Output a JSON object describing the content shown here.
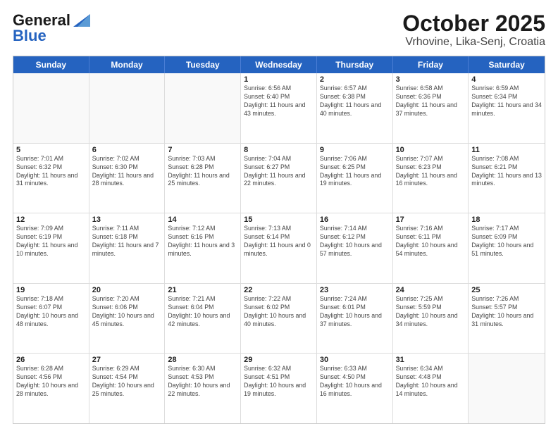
{
  "header": {
    "logo_line1": "General",
    "logo_line2": "Blue",
    "title": "October 2025",
    "subtitle": "Vrhovine, Lika-Senj, Croatia"
  },
  "days_of_week": [
    "Sunday",
    "Monday",
    "Tuesday",
    "Wednesday",
    "Thursday",
    "Friday",
    "Saturday"
  ],
  "weeks": [
    [
      {
        "day": "",
        "info": ""
      },
      {
        "day": "",
        "info": ""
      },
      {
        "day": "",
        "info": ""
      },
      {
        "day": "1",
        "info": "Sunrise: 6:56 AM\nSunset: 6:40 PM\nDaylight: 11 hours and 43 minutes."
      },
      {
        "day": "2",
        "info": "Sunrise: 6:57 AM\nSunset: 6:38 PM\nDaylight: 11 hours and 40 minutes."
      },
      {
        "day": "3",
        "info": "Sunrise: 6:58 AM\nSunset: 6:36 PM\nDaylight: 11 hours and 37 minutes."
      },
      {
        "day": "4",
        "info": "Sunrise: 6:59 AM\nSunset: 6:34 PM\nDaylight: 11 hours and 34 minutes."
      }
    ],
    [
      {
        "day": "5",
        "info": "Sunrise: 7:01 AM\nSunset: 6:32 PM\nDaylight: 11 hours and 31 minutes."
      },
      {
        "day": "6",
        "info": "Sunrise: 7:02 AM\nSunset: 6:30 PM\nDaylight: 11 hours and 28 minutes."
      },
      {
        "day": "7",
        "info": "Sunrise: 7:03 AM\nSunset: 6:28 PM\nDaylight: 11 hours and 25 minutes."
      },
      {
        "day": "8",
        "info": "Sunrise: 7:04 AM\nSunset: 6:27 PM\nDaylight: 11 hours and 22 minutes."
      },
      {
        "day": "9",
        "info": "Sunrise: 7:06 AM\nSunset: 6:25 PM\nDaylight: 11 hours and 19 minutes."
      },
      {
        "day": "10",
        "info": "Sunrise: 7:07 AM\nSunset: 6:23 PM\nDaylight: 11 hours and 16 minutes."
      },
      {
        "day": "11",
        "info": "Sunrise: 7:08 AM\nSunset: 6:21 PM\nDaylight: 11 hours and 13 minutes."
      }
    ],
    [
      {
        "day": "12",
        "info": "Sunrise: 7:09 AM\nSunset: 6:19 PM\nDaylight: 11 hours and 10 minutes."
      },
      {
        "day": "13",
        "info": "Sunrise: 7:11 AM\nSunset: 6:18 PM\nDaylight: 11 hours and 7 minutes."
      },
      {
        "day": "14",
        "info": "Sunrise: 7:12 AM\nSunset: 6:16 PM\nDaylight: 11 hours and 3 minutes."
      },
      {
        "day": "15",
        "info": "Sunrise: 7:13 AM\nSunset: 6:14 PM\nDaylight: 11 hours and 0 minutes."
      },
      {
        "day": "16",
        "info": "Sunrise: 7:14 AM\nSunset: 6:12 PM\nDaylight: 10 hours and 57 minutes."
      },
      {
        "day": "17",
        "info": "Sunrise: 7:16 AM\nSunset: 6:11 PM\nDaylight: 10 hours and 54 minutes."
      },
      {
        "day": "18",
        "info": "Sunrise: 7:17 AM\nSunset: 6:09 PM\nDaylight: 10 hours and 51 minutes."
      }
    ],
    [
      {
        "day": "19",
        "info": "Sunrise: 7:18 AM\nSunset: 6:07 PM\nDaylight: 10 hours and 48 minutes."
      },
      {
        "day": "20",
        "info": "Sunrise: 7:20 AM\nSunset: 6:06 PM\nDaylight: 10 hours and 45 minutes."
      },
      {
        "day": "21",
        "info": "Sunrise: 7:21 AM\nSunset: 6:04 PM\nDaylight: 10 hours and 42 minutes."
      },
      {
        "day": "22",
        "info": "Sunrise: 7:22 AM\nSunset: 6:02 PM\nDaylight: 10 hours and 40 minutes."
      },
      {
        "day": "23",
        "info": "Sunrise: 7:24 AM\nSunset: 6:01 PM\nDaylight: 10 hours and 37 minutes."
      },
      {
        "day": "24",
        "info": "Sunrise: 7:25 AM\nSunset: 5:59 PM\nDaylight: 10 hours and 34 minutes."
      },
      {
        "day": "25",
        "info": "Sunrise: 7:26 AM\nSunset: 5:57 PM\nDaylight: 10 hours and 31 minutes."
      }
    ],
    [
      {
        "day": "26",
        "info": "Sunrise: 6:28 AM\nSunset: 4:56 PM\nDaylight: 10 hours and 28 minutes."
      },
      {
        "day": "27",
        "info": "Sunrise: 6:29 AM\nSunset: 4:54 PM\nDaylight: 10 hours and 25 minutes."
      },
      {
        "day": "28",
        "info": "Sunrise: 6:30 AM\nSunset: 4:53 PM\nDaylight: 10 hours and 22 minutes."
      },
      {
        "day": "29",
        "info": "Sunrise: 6:32 AM\nSunset: 4:51 PM\nDaylight: 10 hours and 19 minutes."
      },
      {
        "day": "30",
        "info": "Sunrise: 6:33 AM\nSunset: 4:50 PM\nDaylight: 10 hours and 16 minutes."
      },
      {
        "day": "31",
        "info": "Sunrise: 6:34 AM\nSunset: 4:48 PM\nDaylight: 10 hours and 14 minutes."
      },
      {
        "day": "",
        "info": ""
      }
    ]
  ]
}
